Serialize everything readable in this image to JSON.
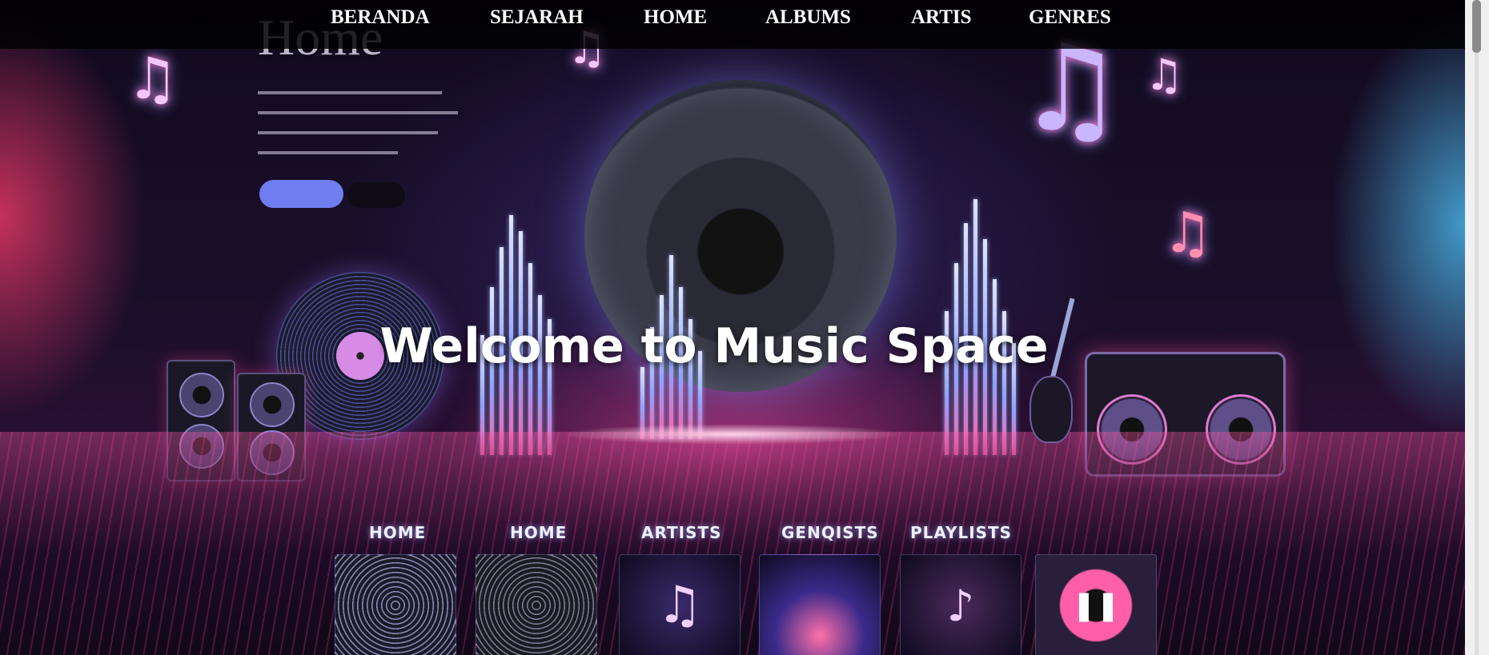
{
  "nav": {
    "items": [
      {
        "label": "BERANDA"
      },
      {
        "label": "SEJARAH"
      },
      {
        "label": "HOME"
      },
      {
        "label": "ALBUMS"
      },
      {
        "label": "ARTIS"
      },
      {
        "label": "GENRES"
      }
    ]
  },
  "hero": {
    "heading": "Welcome to Music Space",
    "background_title": "Home",
    "strip_labels": [
      "HOME",
      "HOME",
      "ARTISTS",
      "GENQISTS",
      "PLAYLISTS"
    ]
  },
  "colors": {
    "nav_bg": "#000000",
    "accent_pink": "#ff5fa8",
    "accent_blue": "#8da2ff",
    "button_blue": "#6f7df0"
  }
}
